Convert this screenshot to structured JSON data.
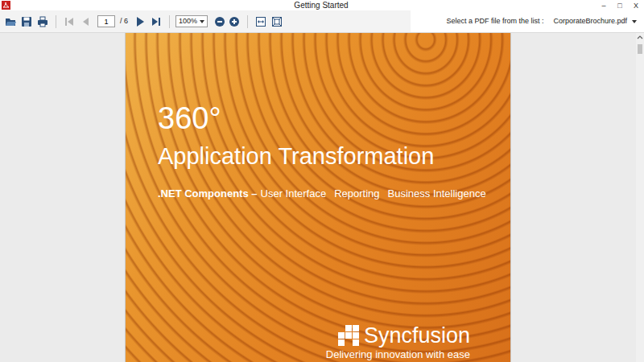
{
  "window": {
    "title": "Getting Started",
    "controls": [
      "–",
      "□",
      "X"
    ]
  },
  "toolbar": {
    "file_buttons": [
      {
        "kind": "open",
        "disabled": false
      },
      {
        "kind": "save",
        "disabled": false
      },
      {
        "kind": "print",
        "disabled": false
      }
    ],
    "nav_back": [
      {
        "kind": "first",
        "disabled": true
      },
      {
        "kind": "previous",
        "disabled": true
      }
    ],
    "page": {
      "value": "1",
      "count": "/ 6"
    },
    "nav_forward": [
      {
        "kind": "next",
        "disabled": false
      },
      {
        "kind": "last",
        "disabled": false
      }
    ],
    "zoom": {
      "value": "100%"
    },
    "zoom_buttons": [
      {
        "kind": "zoom-out",
        "disabled": false
      },
      {
        "kind": "zoom-in",
        "disabled": false
      }
    ],
    "view_buttons": [
      {
        "kind": "fit-width",
        "disabled": false
      },
      {
        "kind": "fit-page",
        "disabled": false
      }
    ]
  },
  "file_picker": {
    "label": "Select a PDF file from the list :",
    "value": "CorporateBrochure.pdf"
  },
  "document": {
    "title": "360°",
    "subtitle": "Application Transformation",
    "tagline": {
      "lead": ".NET Components –",
      "items": [
        "User Interface",
        "Reporting",
        "Business Intelligence"
      ]
    },
    "logo": "Syncfusion",
    "slogan": "Delivering innovation with ease"
  },
  "scrollbar": {
    "level": 0.03
  }
}
